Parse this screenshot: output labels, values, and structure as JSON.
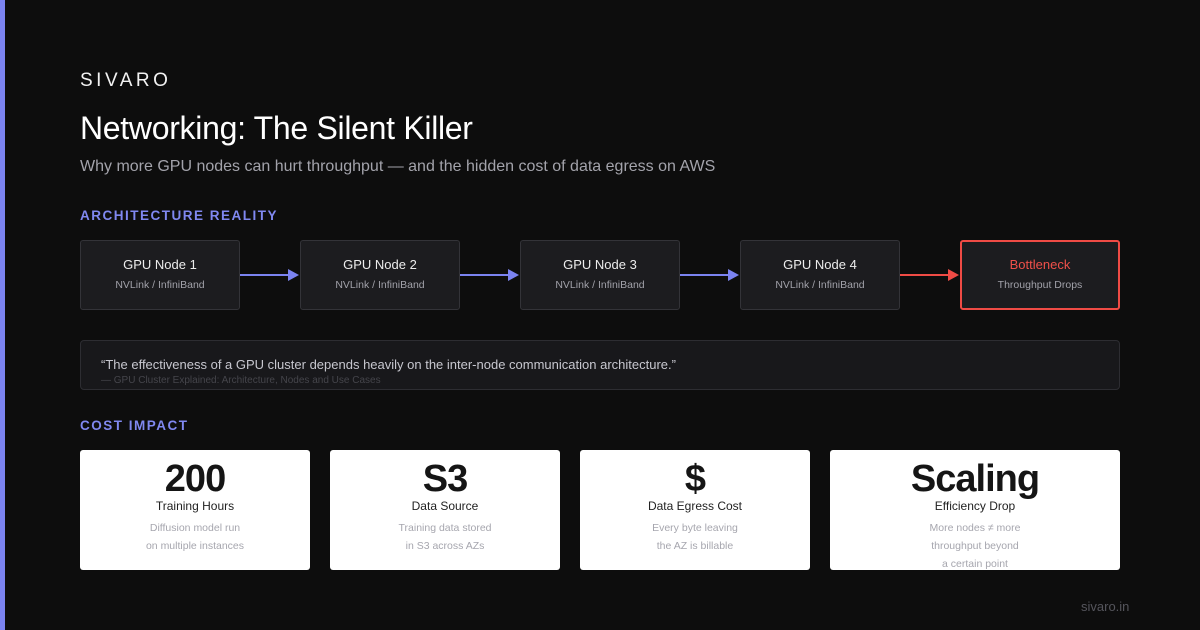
{
  "brand": "SIVARO",
  "title": "Networking: The Silent Killer",
  "subtitle": "Why more GPU nodes can hurt throughput — and the hidden cost of data egress on AWS",
  "sections": {
    "architecture": "ARCHITECTURE REALITY",
    "cost": "COST IMPACT"
  },
  "nodes": [
    {
      "title": "GPU Node 1",
      "sub": "NVLink / InfiniBand"
    },
    {
      "title": "GPU Node 2",
      "sub": "NVLink / InfiniBand"
    },
    {
      "title": "GPU Node 3",
      "sub": "NVLink / InfiniBand"
    },
    {
      "title": "GPU Node 4",
      "sub": "NVLink / InfiniBand"
    },
    {
      "title": "Bottleneck",
      "sub": "Throughput Drops"
    }
  ],
  "quote": {
    "text": "“The effectiveness of a GPU cluster depends heavily on the inter-node communication architecture.”",
    "source": "— GPU Cluster Explained: Architecture, Nodes and Use Cases"
  },
  "cards": [
    {
      "value": "200",
      "label": "Training Hours",
      "desc": [
        "Diffusion model run",
        "on multiple instances"
      ]
    },
    {
      "value": "S3",
      "label": "Data Source",
      "desc": [
        "Training data stored",
        "in S3 across AZs"
      ]
    },
    {
      "value": "$",
      "label": "Data Egress Cost",
      "desc": [
        "Every byte leaving",
        "the AZ is billable"
      ]
    },
    {
      "value": "Scaling",
      "label": "Efficiency Drop",
      "desc": [
        "More nodes ≠ more",
        "throughput beyond",
        "a certain point"
      ]
    }
  ],
  "footer": "sivaro.in",
  "colors": {
    "accent": "#7b83f0",
    "danger": "#ef4b45",
    "background": "#0d0d0d"
  }
}
